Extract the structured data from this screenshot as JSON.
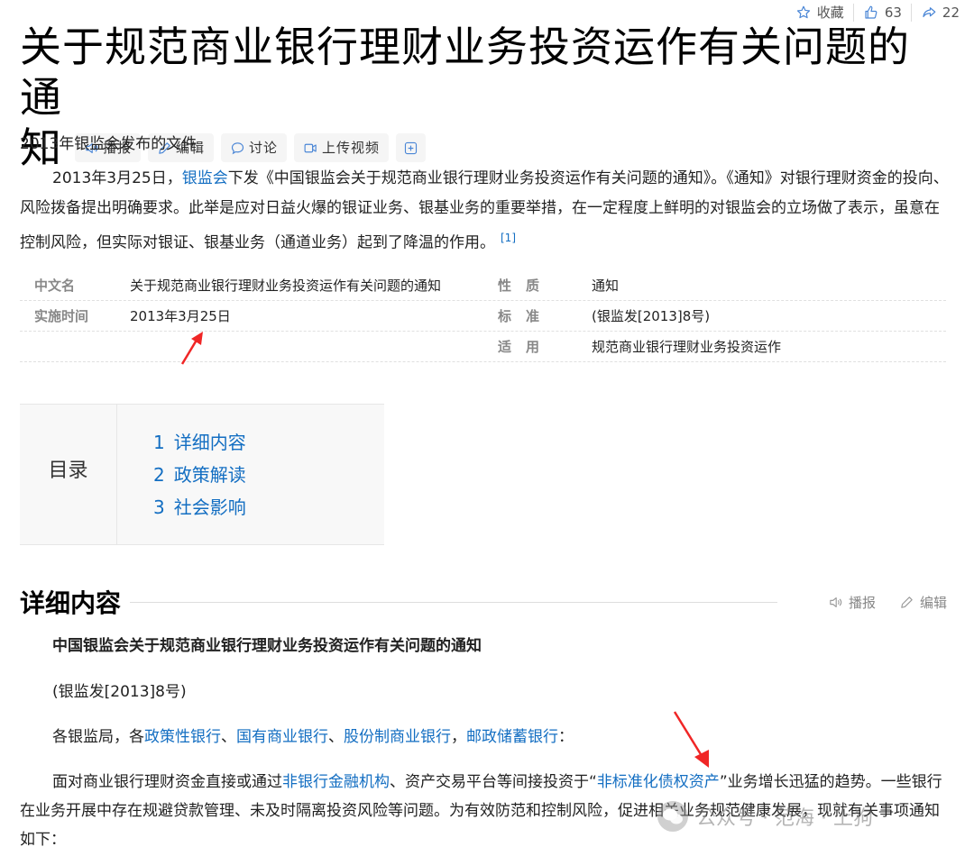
{
  "top_actions": {
    "favorite_label": "收藏",
    "like_count": "63",
    "share_count": "22"
  },
  "title": {
    "line1": "关于规范商业银行理财业务投资运作有关问题的通",
    "line2": "知"
  },
  "title_tools": {
    "listen": "播报",
    "edit": "编辑",
    "discuss": "讨论",
    "upload_video": "上传视频"
  },
  "subtitle": "2013年银监会发布的文件",
  "summary": {
    "before_link": "2013年3月25日，",
    "link": "银监会",
    "after_link": "下发《中国银监会关于规范商业银行理财业务投资运作有关问题的通知》。《通知》对银行理财资金的投向、风险拨备提出明确要求。此举是应对日益火爆的银证业务、银基业务的重要举措，在一定程度上鲜明的对银监会的立场做了表示，虽意在控制风险，但实际对银证、银基业务（通道业务）起到了降温的作用。",
    "ref": "[1]"
  },
  "info_table": [
    {
      "k1": "中文名",
      "v1": "关于规范商业银行理财业务投资运作有关问题的通知",
      "k2": "性质",
      "v2": "通知"
    },
    {
      "k1": "实施时间",
      "v1": "2013年3月25日",
      "k2": "标准",
      "v2": "(银监发[2013]8号)"
    },
    {
      "k1": "",
      "v1": "",
      "k2": "适用",
      "v2": "规范商业银行理财业务投资运作"
    }
  ],
  "catalog": {
    "title": "目录",
    "items": [
      {
        "num": "1",
        "label": "详细内容"
      },
      {
        "num": "2",
        "label": "政策解读"
      },
      {
        "num": "3",
        "label": "社会影响"
      }
    ]
  },
  "section": {
    "title": "详细内容",
    "listen": "播报",
    "edit": "编辑"
  },
  "content": {
    "p1": "中国银监会关于规范商业银行理财业务投资运作有关问题的通知",
    "p2": "(银监发[2013]8号)",
    "p3_prefix": "各银监局，各",
    "p3_links": [
      "政策性银行",
      "国有商业银行",
      "股份制商业银行",
      "邮政储蓄银行"
    ],
    "p3_sep1": "、",
    "p3_sep2": "，",
    "p3_suffix": "：",
    "p4_a": "面对商业银行理财资金直接或通过",
    "p4_link1": "非银行金融机构",
    "p4_b": "、资产交易平台等间接投资于“",
    "p4_link2": "非标准化债权资产",
    "p4_c": "”业务增长迅猛的趋势。一些银行在业务开展中存在规避贷款管理、未及时隔离投资风险等问题。为有效防范和控制风险，促进相关业务规范健康发展，现就有关事项通知如下："
  },
  "watermark": "公众号 · 范海 · 上狗",
  "colors": {
    "link": "#136ec2",
    "arrow": "#f02626"
  }
}
